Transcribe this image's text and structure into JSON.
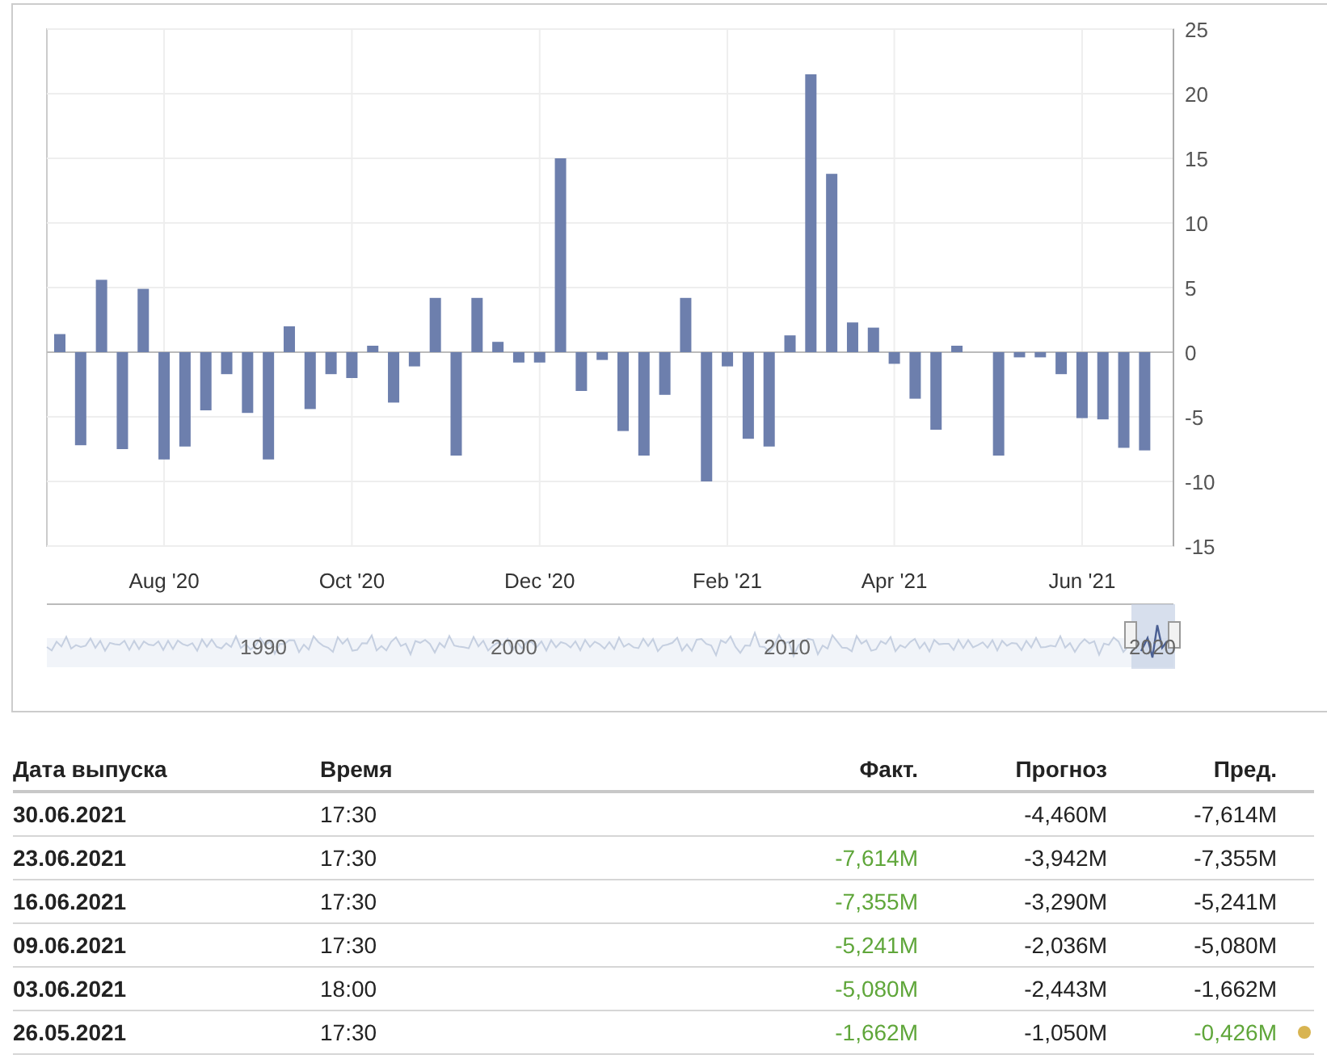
{
  "chart": {
    "chart_data": {
      "type": "bar",
      "categories": [
        null,
        null,
        null,
        null,
        null,
        "Aug '20",
        null,
        null,
        null,
        null,
        null,
        null,
        null,
        null,
        "Oct '20",
        null,
        null,
        null,
        null,
        null,
        null,
        null,
        null,
        "Dec '20",
        null,
        null,
        null,
        null,
        null,
        null,
        null,
        null,
        "Feb '21",
        null,
        null,
        null,
        null,
        null,
        null,
        null,
        "Apr '21",
        null,
        null,
        null,
        null,
        null,
        null,
        null,
        null,
        "Jun '21",
        null,
        null,
        null
      ],
      "series": [
        {
          "color": "#6d7fad",
          "values": [
            1.4,
            -7.2,
            5.6,
            -7.5,
            4.9,
            -8.3,
            -7.3,
            -4.5,
            -1.7,
            -4.7,
            -8.3,
            2.0,
            -4.4,
            -1.7,
            -2.0,
            0.5,
            -3.9,
            -1.1,
            4.2,
            -8.0,
            4.2,
            0.8,
            -0.8,
            -0.8,
            15.0,
            -3.0,
            -0.6,
            -6.1,
            -8.0,
            -3.3,
            4.2,
            -10.0,
            -1.1,
            -6.7,
            -7.3,
            1.3,
            21.5,
            13.8,
            2.3,
            1.9,
            -0.9,
            -3.6,
            -6.0,
            0.5,
            null,
            -8.0,
            -0.4,
            -0.4,
            -1.7,
            -5.1,
            -5.2,
            -7.4,
            -7.6
          ]
        }
      ],
      "grid": true,
      "ylim": [
        -15,
        25
      ],
      "yticks": [
        -15,
        -10,
        -5,
        0,
        5,
        10,
        15,
        20,
        25
      ]
    },
    "navigator": {
      "labels": [
        "1990",
        "2000",
        "2010",
        "2020"
      ]
    }
  },
  "table": {
    "columns": [
      "Дата выпуска",
      "Время",
      "Факт.",
      "Прогноз",
      "Пред."
    ],
    "rows": [
      {
        "date": "30.06.2021",
        "time": "17:30",
        "forecast": "-4,460M",
        "previous": "-7,614M",
        "previous_positive": false,
        "revised": false
      },
      {
        "date": "23.06.2021",
        "time": "17:30",
        "actual": "-7,614M",
        "actual_positive": true,
        "forecast": "-3,942M",
        "previous": "-7,355M",
        "previous_positive": false,
        "revised": false
      },
      {
        "date": "16.06.2021",
        "time": "17:30",
        "actual": "-7,355M",
        "actual_positive": true,
        "forecast": "-3,290M",
        "previous": "-5,241M",
        "previous_positive": false,
        "revised": false
      },
      {
        "date": "09.06.2021",
        "time": "17:30",
        "actual": "-5,241M",
        "actual_positive": true,
        "forecast": "-2,036M",
        "previous": "-5,080M",
        "previous_positive": false,
        "revised": false
      },
      {
        "date": "03.06.2021",
        "time": "18:00",
        "actual": "-5,080M",
        "actual_positive": true,
        "forecast": "-2,443M",
        "previous": "-1,662M",
        "previous_positive": false,
        "revised": false
      },
      {
        "date": "26.05.2021",
        "time": "17:30",
        "actual": "-1,662M",
        "actual_positive": true,
        "forecast": "-1,050M",
        "previous": "-0,426M",
        "previous_positive": true,
        "revised": true
      }
    ]
  }
}
